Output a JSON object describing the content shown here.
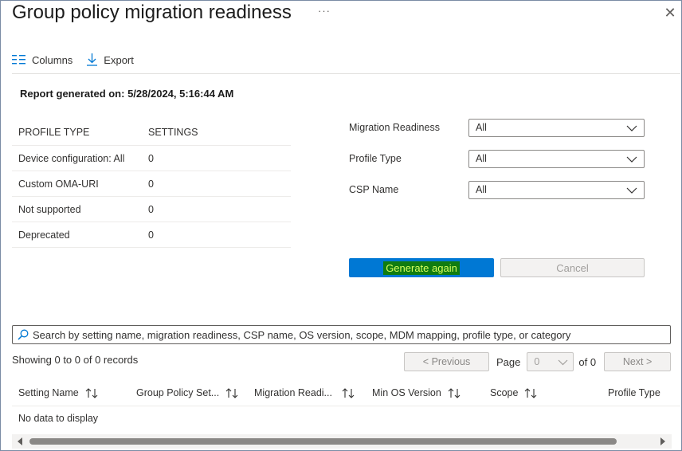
{
  "header": {
    "title": "Group policy migration readiness",
    "more_label": "···",
    "close_label": "✕"
  },
  "toolbar": {
    "columns_label": "Columns",
    "export_label": "Export"
  },
  "report": {
    "generated_text": "Report generated on: 5/28/2024, 5:16:44 AM"
  },
  "summary_table": {
    "headers": [
      "PROFILE TYPE",
      "SETTINGS"
    ],
    "rows": [
      {
        "profile_type": "Device configuration: All",
        "settings": "0"
      },
      {
        "profile_type": "Custom OMA-URI",
        "settings": "0"
      },
      {
        "profile_type": "Not supported",
        "settings": "0"
      },
      {
        "profile_type": "Deprecated",
        "settings": "0"
      }
    ]
  },
  "filters": {
    "migration_readiness": {
      "label": "Migration Readiness",
      "value": "All"
    },
    "profile_type": {
      "label": "Profile Type",
      "value": "All"
    },
    "csp_name": {
      "label": "CSP Name",
      "value": "All"
    }
  },
  "actions": {
    "generate_label": "Generate again",
    "cancel_label": "Cancel"
  },
  "search": {
    "placeholder": "Search by setting name, migration readiness, CSP name, OS version, scope, MDM mapping, profile type, or category"
  },
  "pagination": {
    "showing_text": "Showing 0 to 0 of 0 records",
    "previous_label": "< Previous",
    "page_label": "Page",
    "page_value": "0",
    "of_text": "of 0",
    "next_label": "Next >"
  },
  "grid": {
    "columns": [
      "Setting Name",
      "Group Policy Set...",
      "Migration Readi...",
      "Min OS Version",
      "Scope",
      "Profile Type"
    ],
    "empty_text": "No data to display"
  },
  "colors": {
    "primary": "#0078d4",
    "highlight_bg": "#107c10",
    "highlight_text": "#d6ff5e",
    "border": "#7a8ca5"
  }
}
